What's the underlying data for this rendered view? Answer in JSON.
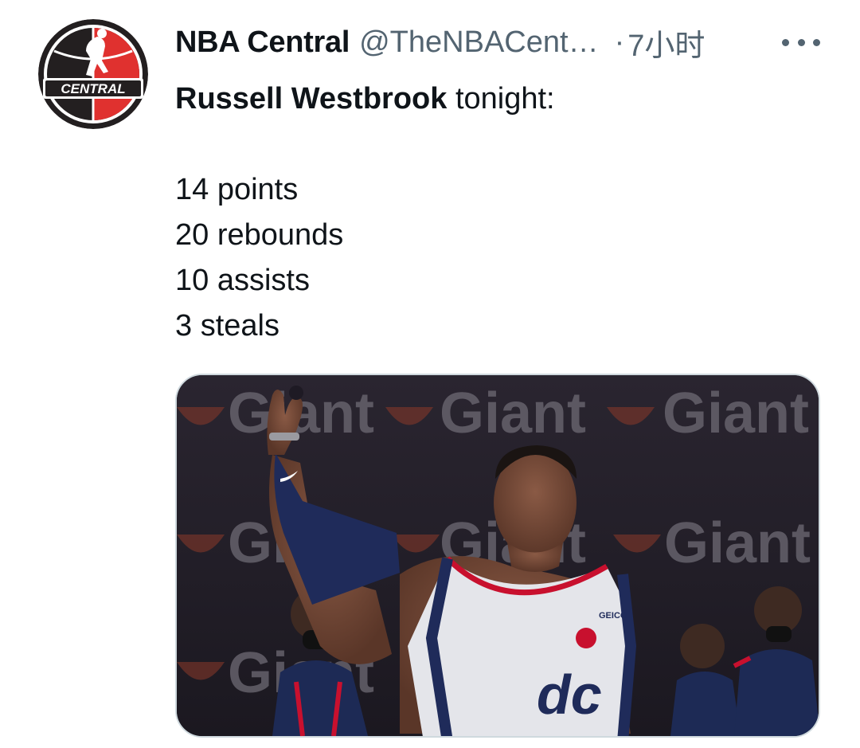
{
  "tweet": {
    "display_name": "NBA Central",
    "handle": "@TheNBACent…",
    "separator": "·",
    "time": "7小时",
    "avatar_logo_text": "CENTRAL",
    "more_icon": "more-dots-icon",
    "text": {
      "player_name": "Russell Westbrook",
      "intro_rest": " tonight:",
      "stats": [
        "14 points",
        "20 rebounds",
        "10 assists",
        "3 steals"
      ]
    },
    "media": {
      "backdrop_text": "Giant",
      "jersey_sponsor": "GEICO",
      "jersey_logo": "dc"
    }
  },
  "colors": {
    "primary_text": "#0f1419",
    "secondary_text": "#536471",
    "media_border": "#cfd9de",
    "logo_red": "#e0312f",
    "logo_dark": "#231f20"
  }
}
